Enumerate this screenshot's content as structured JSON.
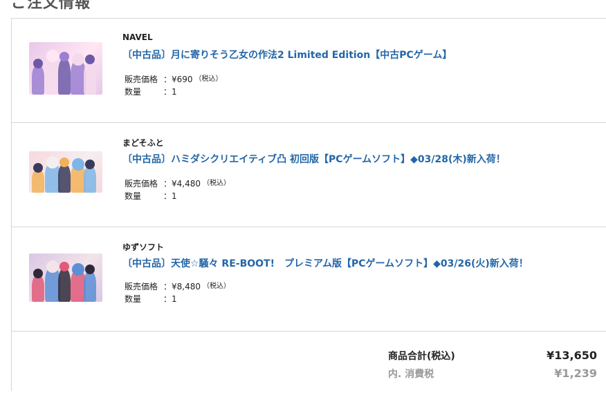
{
  "section": {
    "heading": "ご注文情報"
  },
  "items": [
    {
      "maker": "NAVEL",
      "title": "〔中古品〕月に寄りそう乙女の作法2 Limited Edition【中古PCゲーム】",
      "price_label": "販売価格",
      "price_value": "：¥690",
      "tax_note": "（税込）",
      "qty_label": "数量",
      "qty_value": "：1",
      "thumb_colors": [
        "#e8c7e9",
        "#9b7fd1",
        "#f4d9ec",
        "#6c5aa8",
        "#ffe7f3"
      ]
    },
    {
      "maker": "まどそふと",
      "title": "〔中古品〕ハミダシクリエイティブ凸 初回版【PCゲームソフト】◆03/28(木)新入荷！",
      "price_label": "販売価格",
      "price_value": "：¥4,480",
      "tax_note": "（税込）",
      "qty_label": "数量",
      "qty_value": "：1",
      "thumb_colors": [
        "#f7d8dd",
        "#f2b15a",
        "#7fb6e8",
        "#3a3a5a",
        "#f5eef0"
      ]
    },
    {
      "maker": "ゆずソフト",
      "title": "〔中古品〕天使☆騒々 RE-BOOT!　プレミアム版【PCゲームソフト】◆03/26(火)新入荷！",
      "price_label": "販売価格",
      "price_value": "：¥8,480",
      "tax_note": "（税込）",
      "qty_label": "数量",
      "qty_value": "：1",
      "thumb_colors": [
        "#d9c7e3",
        "#e05a7a",
        "#5c8fd6",
        "#2f2a3a",
        "#f3e3ea"
      ]
    }
  ],
  "totals": {
    "subtotal_label": "商品合計(税込)",
    "subtotal_value": "¥13,650",
    "tax_label": "内. 消費税",
    "tax_value": "¥1,239"
  },
  "colors": {
    "link": "#2366a8",
    "border": "#d6d6d6",
    "muted": "#999999"
  }
}
